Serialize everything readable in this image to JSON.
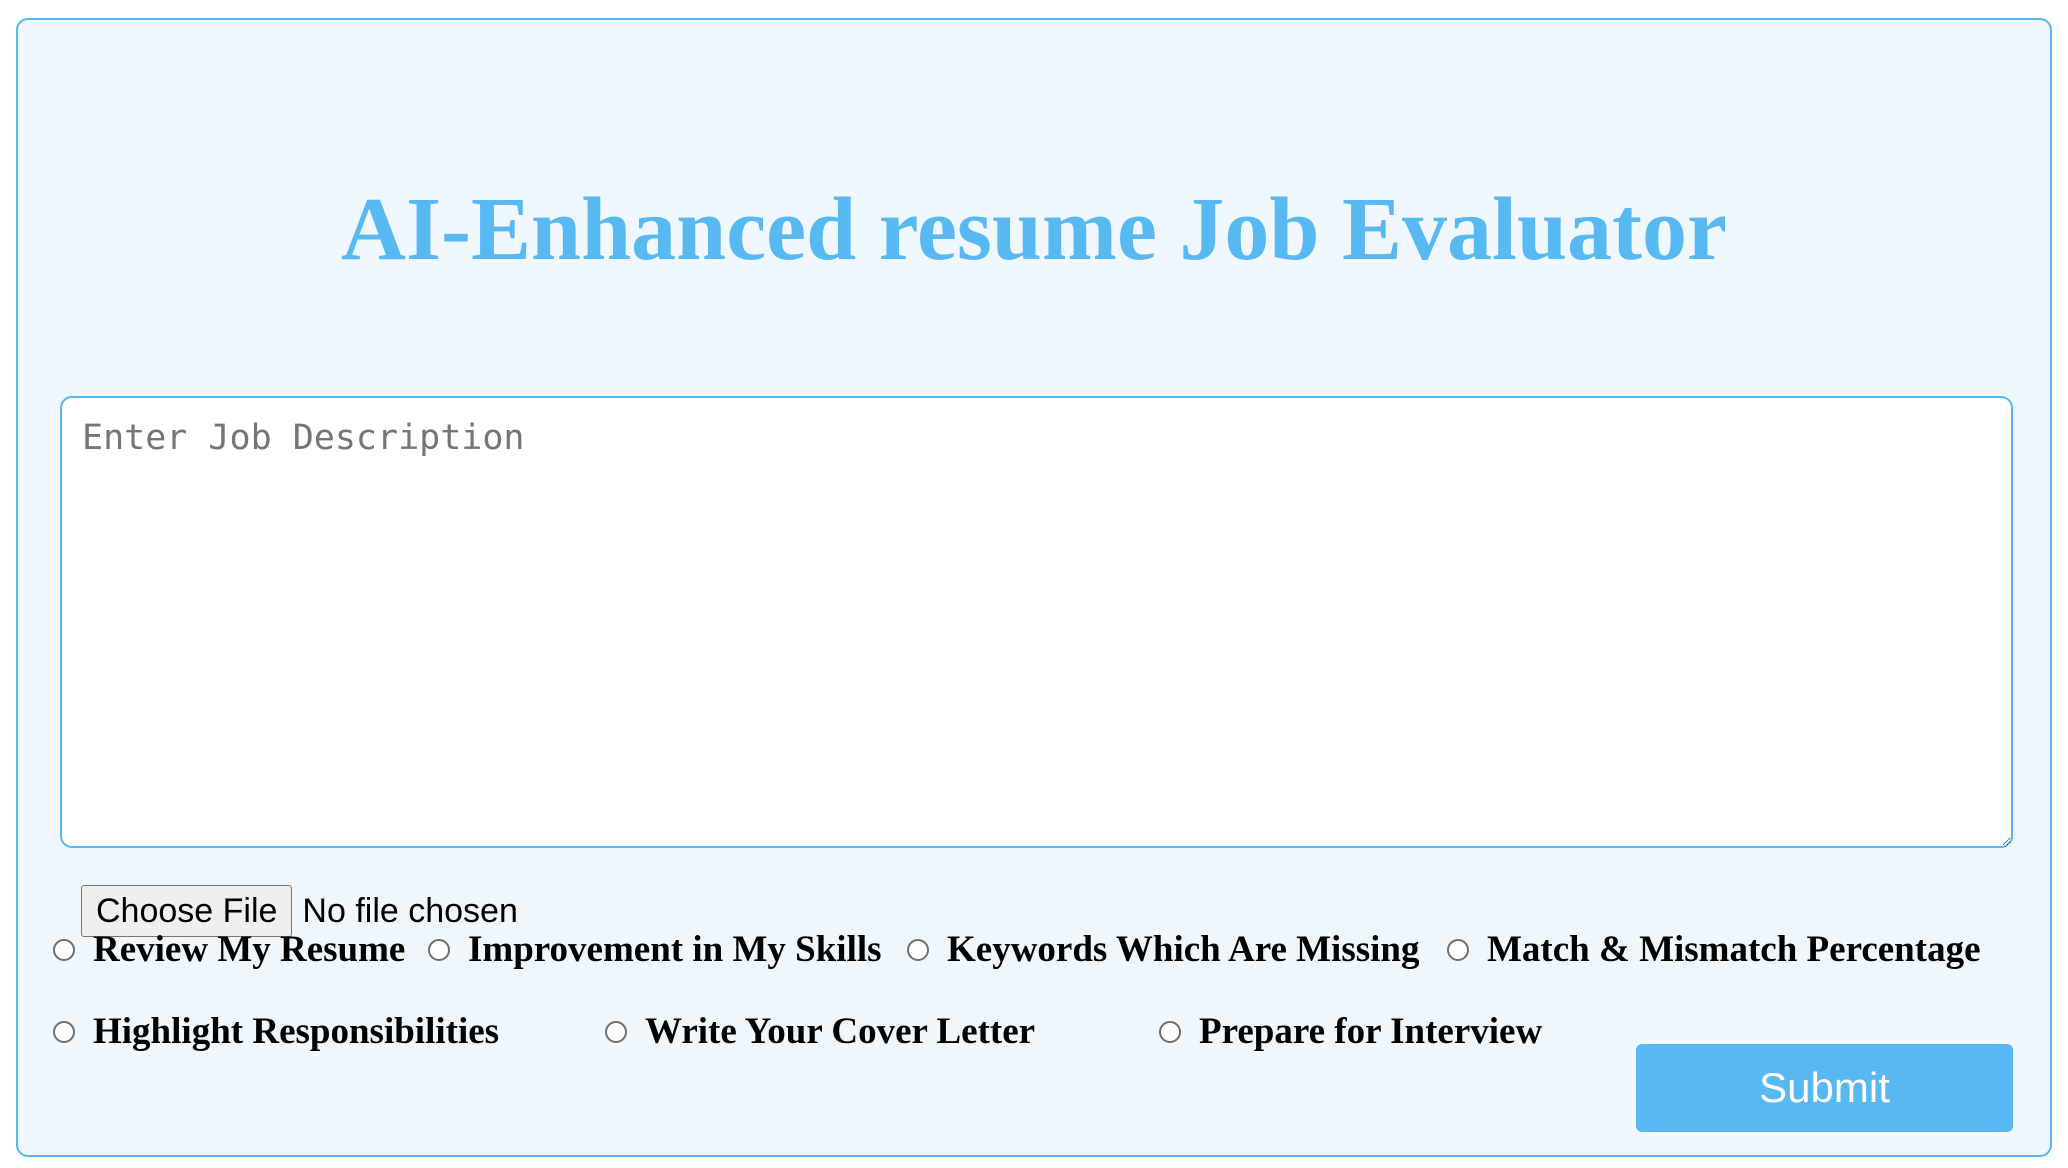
{
  "page": {
    "title": "AI-Enhanced resume Job Evaluator"
  },
  "job_description": {
    "placeholder": "Enter Job Description",
    "value": ""
  },
  "file_upload": {
    "button_label": "Choose File",
    "status": "No file chosen"
  },
  "options": [
    {
      "label": "Review My Resume",
      "selected": false
    },
    {
      "label": "Improvement in My Skills",
      "selected": false
    },
    {
      "label": "Keywords Which Are Missing",
      "selected": false
    },
    {
      "label": "Match & Mismatch Percentage",
      "selected": false
    },
    {
      "label": "Highlight Responsibilities",
      "selected": false
    },
    {
      "label": "Write Your Cover Letter",
      "selected": false
    },
    {
      "label": "Prepare for Interview",
      "selected": false
    }
  ],
  "submit": {
    "label": "Submit"
  },
  "colors": {
    "accent": "#58b9f2",
    "border": "#54b8ee",
    "card_background": "#eff7fc"
  }
}
